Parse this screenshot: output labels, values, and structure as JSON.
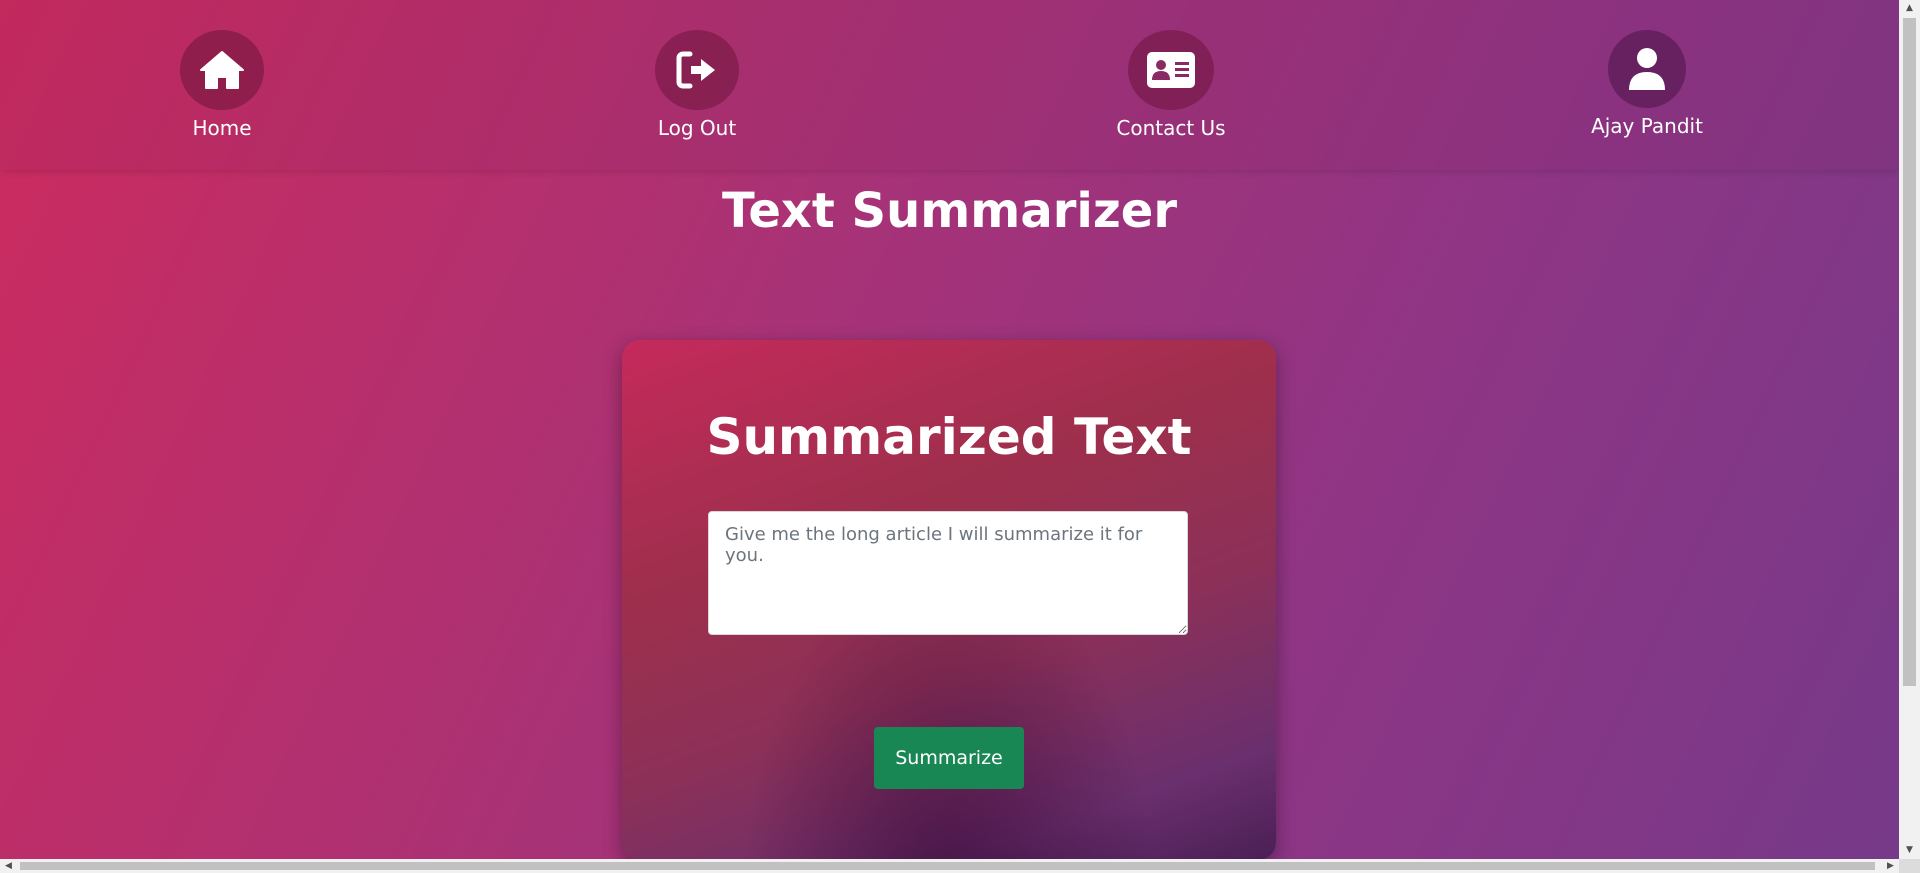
{
  "nav": {
    "items": [
      {
        "label": "Home",
        "icon": "home-icon"
      },
      {
        "label": "Log Out",
        "icon": "logout-icon"
      },
      {
        "label": "Contact Us",
        "icon": "contact-card-icon"
      },
      {
        "label": "Ajay Pandit",
        "icon": "user-icon"
      }
    ]
  },
  "main": {
    "title": "Text Summarizer"
  },
  "card": {
    "title": "Summarized Text",
    "textarea_placeholder": "Give me the long article I will summarize it for you.",
    "textarea_value": "",
    "button_label": "Summarize"
  },
  "colors": {
    "gradient_start": "#cc2b5e",
    "gradient_end": "#753a88",
    "button": "#198754",
    "text": "#ffffff"
  }
}
